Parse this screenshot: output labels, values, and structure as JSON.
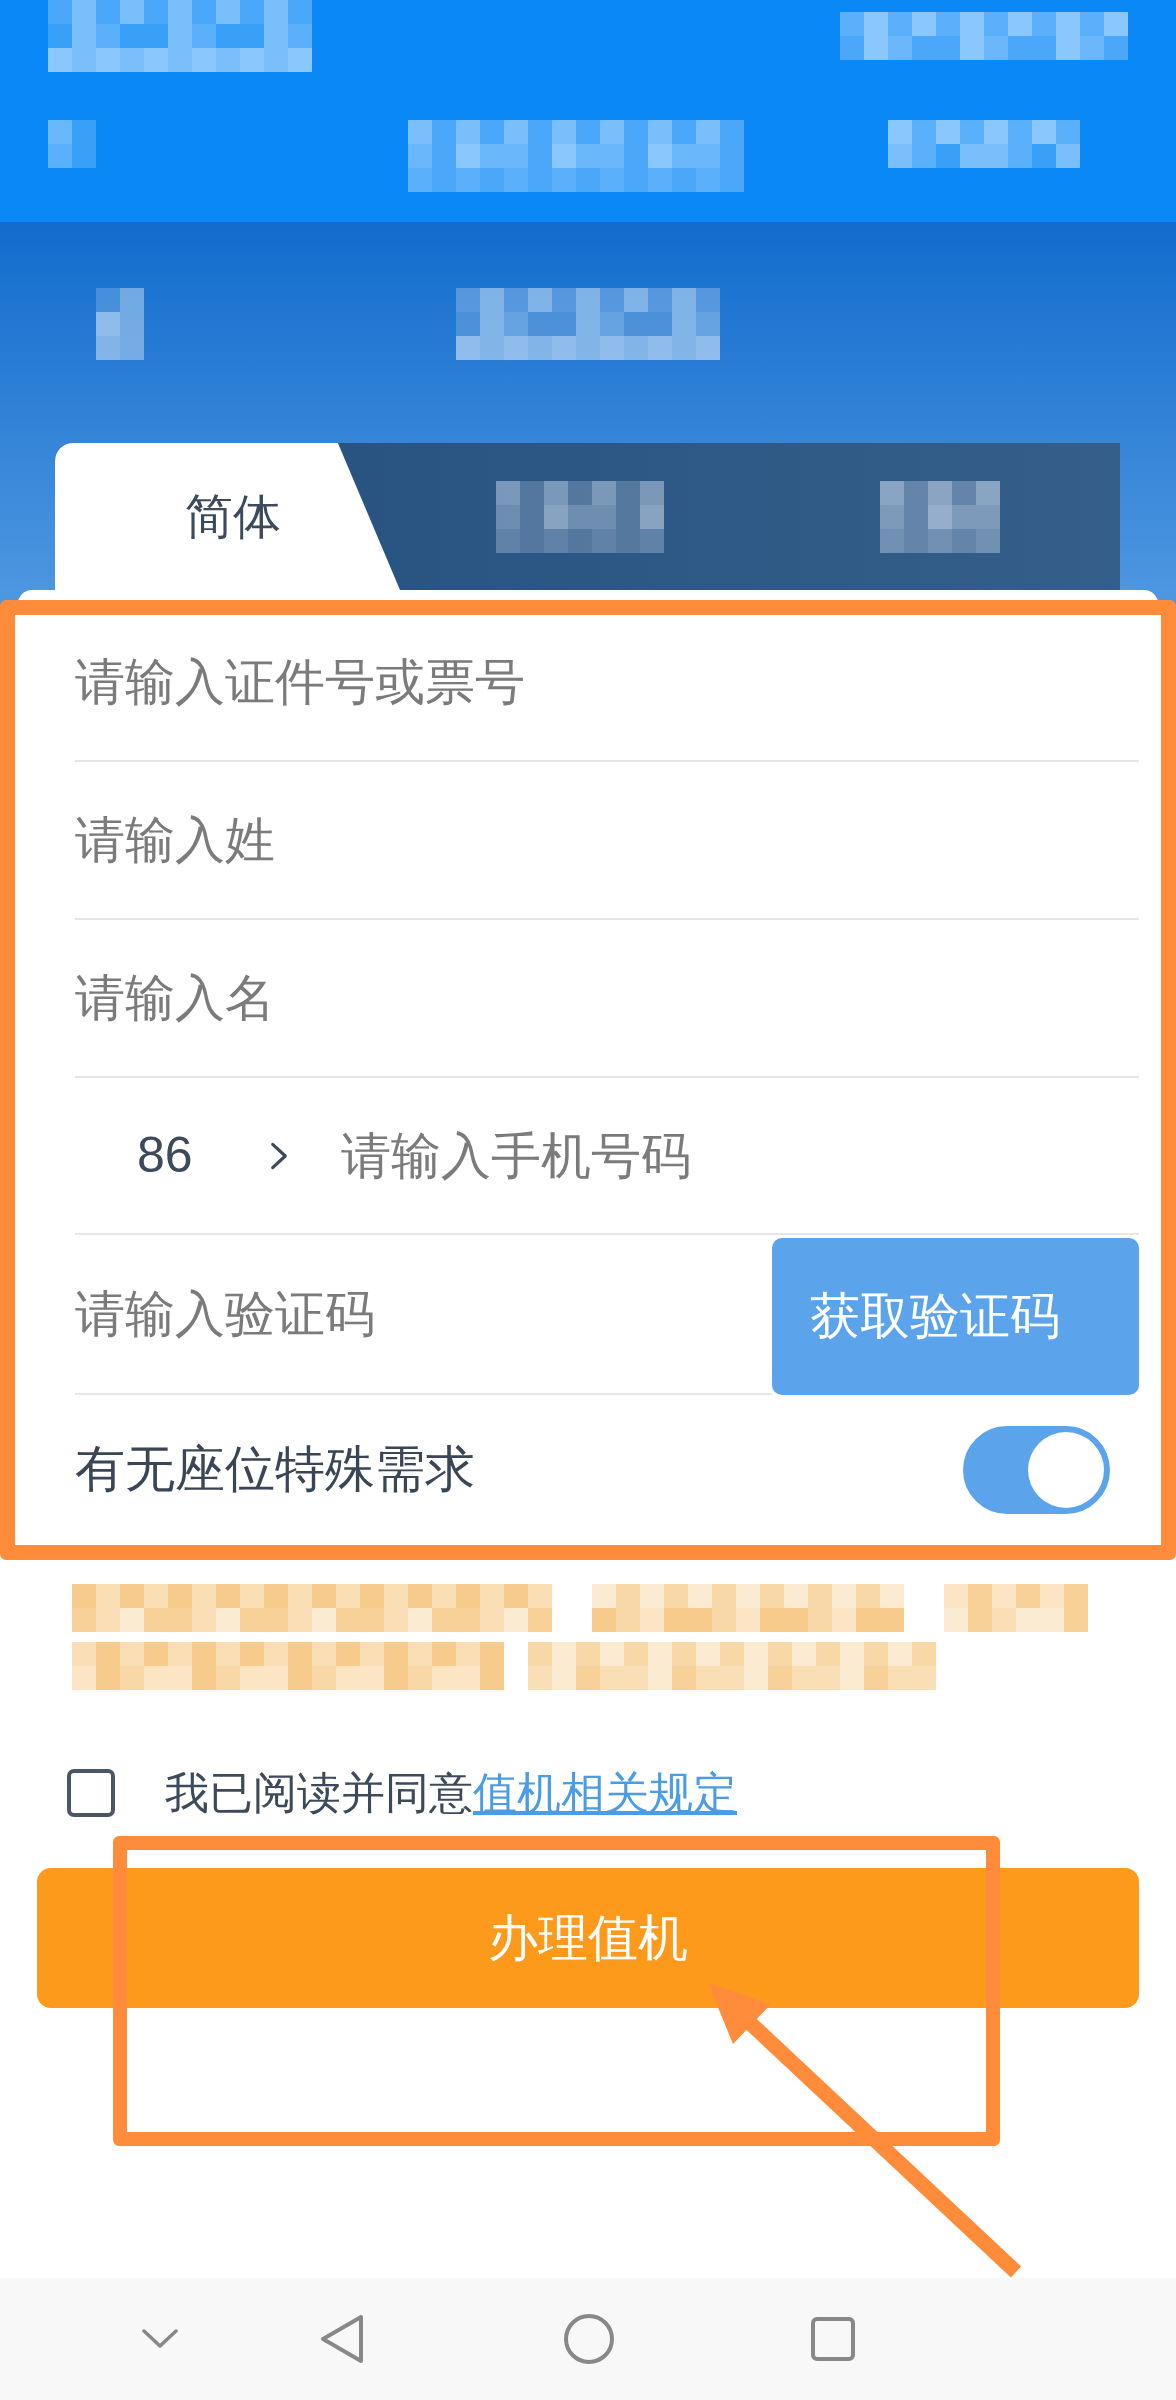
{
  "tabs": [
    {
      "label": "简体",
      "selected": true
    },
    {
      "selected": false
    },
    {
      "selected": false
    }
  ],
  "form": {
    "fields": [
      {
        "kind": "text",
        "placeholder": "请输入证件号或票号"
      },
      {
        "kind": "text",
        "placeholder": "请输入姓"
      },
      {
        "kind": "text",
        "placeholder": "请输入名"
      },
      {
        "kind": "phone",
        "country_code": "86",
        "placeholder": "请输入手机号码"
      },
      {
        "kind": "code",
        "placeholder": "请输入验证码",
        "button": "获取验证码"
      },
      {
        "kind": "toggle",
        "label": "有无座位特殊需求",
        "on": true
      }
    ]
  },
  "agreement": {
    "checked": false,
    "text": "我已阅读并同意",
    "link": "值机相关规定"
  },
  "submit_button": {
    "label": "办理值机"
  }
}
